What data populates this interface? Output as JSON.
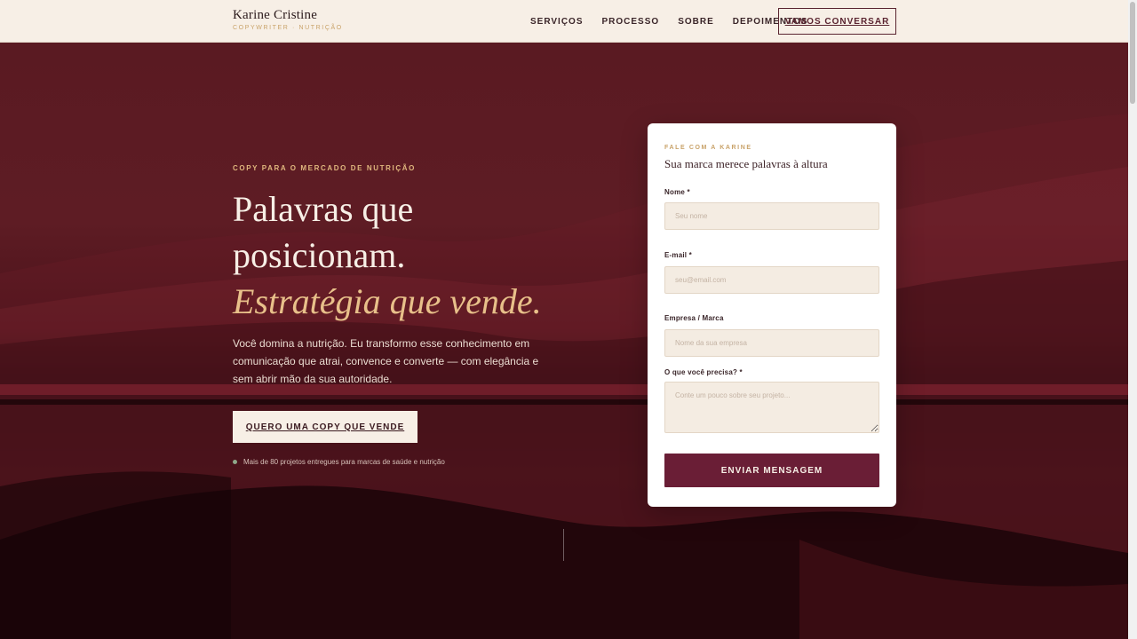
{
  "header": {
    "brand_name": "Karine Cristine",
    "brand_sub": "COPYWRITER · NUTRIÇÃO",
    "nav": [
      "SERVIÇOS",
      "PROCESSO",
      "SOBRE",
      "DEPOIMENTOS"
    ],
    "cta": "VAMOS CONVERSAR"
  },
  "hero": {
    "eyebrow": "COPY PARA O MERCADO DE NUTRIÇÃO",
    "title_line1": "Palavras que",
    "title_line2": "posicionam.",
    "title_accent": "Estratégia que vende.",
    "lead": "Você domina a nutrição. Eu transformo esse conhecimento em comunicação que atrai, convence e converte — com elegância e sem abrir mão da sua autoridade.",
    "cta": "QUERO UMA COPY QUE VENDE",
    "proof": "Mais de 80 projetos entregues para marcas de saúde e nutrição"
  },
  "form": {
    "eyebrow": "FALE COM A KARINE",
    "title": "Sua marca merece palavras à altura",
    "name_label": "Nome *",
    "name_placeholder": "Seu nome",
    "email_label": "E-mail *",
    "email_placeholder": "seu@email.com",
    "company_label": "Empresa / Marca",
    "company_placeholder": "Nome da sua empresa",
    "need_label": "O que você precisa? *",
    "need_placeholder": "Conte um pouco sobre seu projeto...",
    "submit": "ENVIAR MENSAGEM"
  },
  "colors": {
    "accent_gold": "#e8c08a",
    "burgundy": "#6a1e36",
    "cream": "#f7efe6"
  }
}
